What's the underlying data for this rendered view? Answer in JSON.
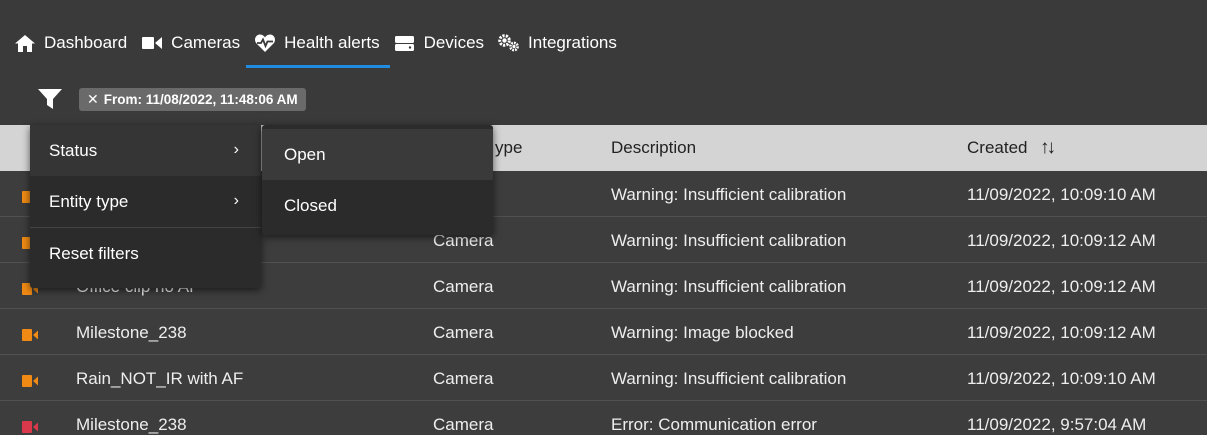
{
  "nav": {
    "items": [
      {
        "label": "Dashboard",
        "icon": "home-icon"
      },
      {
        "label": "Cameras",
        "icon": "video-camera-icon"
      },
      {
        "label": "Health alerts",
        "icon": "heartbeat-icon",
        "active": true
      },
      {
        "label": "Devices",
        "icon": "server-icon"
      },
      {
        "label": "Integrations",
        "icon": "gears-icon"
      }
    ],
    "accent": "#1f8ce0"
  },
  "filter": {
    "chip_close": "✕",
    "chip_label": "From: 11/08/2022, 11:48:06 AM"
  },
  "menu": {
    "items": [
      {
        "label": "Status",
        "arrow": "›"
      },
      {
        "label": "Entity type",
        "arrow": "›"
      },
      {
        "label": "Reset filters"
      }
    ],
    "submenu": [
      {
        "label": "Open"
      },
      {
        "label": "Closed"
      }
    ]
  },
  "table": {
    "headers": {
      "type_partial": "ype",
      "description": "Description",
      "created": "Created",
      "sort_icon": "↑↓"
    },
    "rows": [
      {
        "status_color": "#f08a14",
        "name": "",
        "type": "a",
        "description": "Warning: Insufficient calibration",
        "created": "11/09/2022, 10:09:10 AM"
      },
      {
        "status_color": "#f08a14",
        "name": "",
        "type": "Camera",
        "description": "Warning: Insufficient calibration",
        "created": "11/09/2022, 10:09:12 AM"
      },
      {
        "status_color": "#f08a14",
        "name": "Office clip no AF",
        "type": "Camera",
        "description": "Warning: Insufficient calibration",
        "created": "11/09/2022, 10:09:12 AM"
      },
      {
        "status_color": "#f08a14",
        "name": "Milestone_238",
        "type": "Camera",
        "description": "Warning: Image blocked",
        "created": "11/09/2022, 10:09:12 AM"
      },
      {
        "status_color": "#f08a14",
        "name": "Rain_NOT_IR with AF",
        "type": "Camera",
        "description": "Warning: Insufficient calibration",
        "created": "11/09/2022, 10:09:10 AM"
      },
      {
        "status_color": "#d9394a",
        "name": "Milestone_238",
        "type": "Camera",
        "description": "Error: Communication error",
        "created": "11/09/2022, 9:57:04 AM"
      }
    ]
  }
}
